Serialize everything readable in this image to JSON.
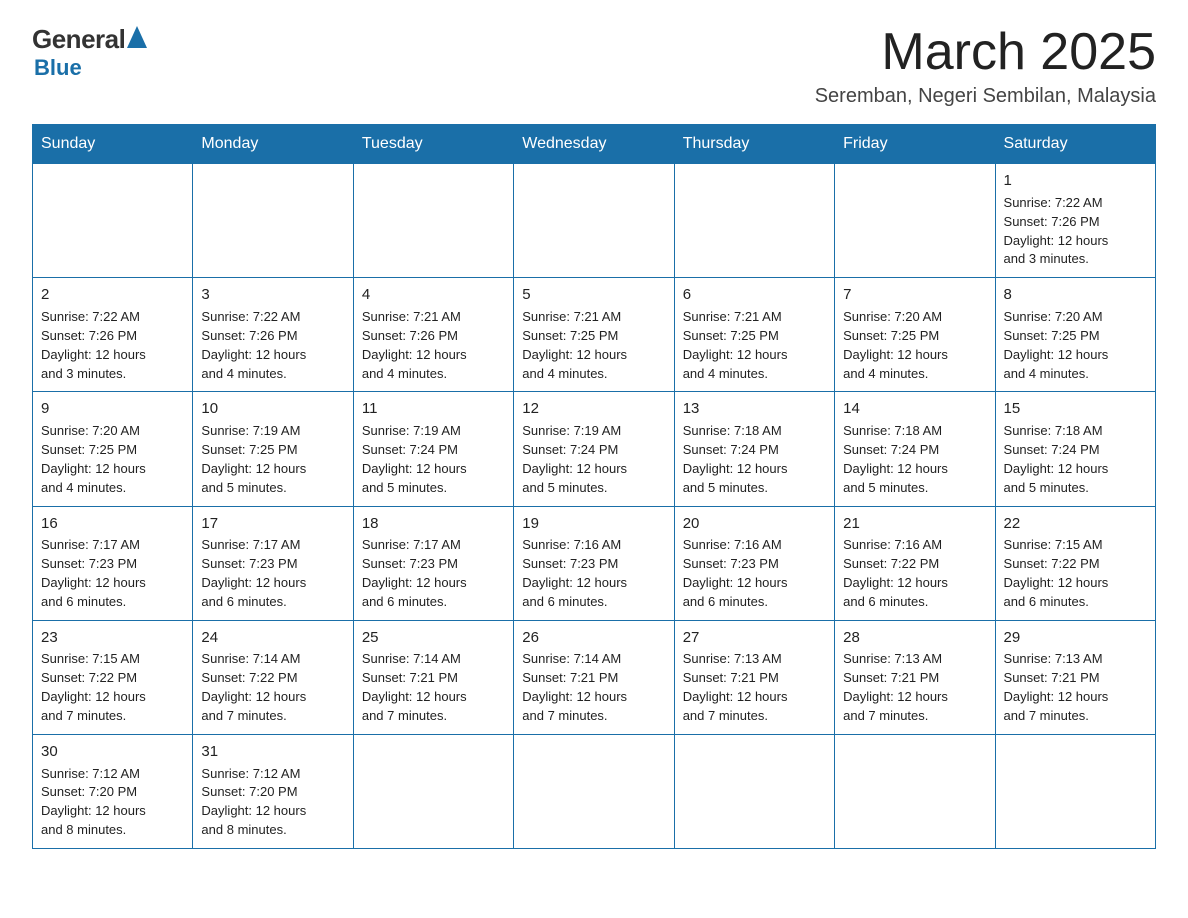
{
  "header": {
    "logo_general": "General",
    "logo_blue": "Blue",
    "month_title": "March 2025",
    "location": "Seremban, Negeri Sembilan, Malaysia"
  },
  "weekdays": [
    "Sunday",
    "Monday",
    "Tuesday",
    "Wednesday",
    "Thursday",
    "Friday",
    "Saturday"
  ],
  "weeks": [
    [
      {
        "day": "",
        "info": ""
      },
      {
        "day": "",
        "info": ""
      },
      {
        "day": "",
        "info": ""
      },
      {
        "day": "",
        "info": ""
      },
      {
        "day": "",
        "info": ""
      },
      {
        "day": "",
        "info": ""
      },
      {
        "day": "1",
        "info": "Sunrise: 7:22 AM\nSunset: 7:26 PM\nDaylight: 12 hours\nand 3 minutes."
      }
    ],
    [
      {
        "day": "2",
        "info": "Sunrise: 7:22 AM\nSunset: 7:26 PM\nDaylight: 12 hours\nand 3 minutes."
      },
      {
        "day": "3",
        "info": "Sunrise: 7:22 AM\nSunset: 7:26 PM\nDaylight: 12 hours\nand 4 minutes."
      },
      {
        "day": "4",
        "info": "Sunrise: 7:21 AM\nSunset: 7:26 PM\nDaylight: 12 hours\nand 4 minutes."
      },
      {
        "day": "5",
        "info": "Sunrise: 7:21 AM\nSunset: 7:25 PM\nDaylight: 12 hours\nand 4 minutes."
      },
      {
        "day": "6",
        "info": "Sunrise: 7:21 AM\nSunset: 7:25 PM\nDaylight: 12 hours\nand 4 minutes."
      },
      {
        "day": "7",
        "info": "Sunrise: 7:20 AM\nSunset: 7:25 PM\nDaylight: 12 hours\nand 4 minutes."
      },
      {
        "day": "8",
        "info": "Sunrise: 7:20 AM\nSunset: 7:25 PM\nDaylight: 12 hours\nand 4 minutes."
      }
    ],
    [
      {
        "day": "9",
        "info": "Sunrise: 7:20 AM\nSunset: 7:25 PM\nDaylight: 12 hours\nand 4 minutes."
      },
      {
        "day": "10",
        "info": "Sunrise: 7:19 AM\nSunset: 7:25 PM\nDaylight: 12 hours\nand 5 minutes."
      },
      {
        "day": "11",
        "info": "Sunrise: 7:19 AM\nSunset: 7:24 PM\nDaylight: 12 hours\nand 5 minutes."
      },
      {
        "day": "12",
        "info": "Sunrise: 7:19 AM\nSunset: 7:24 PM\nDaylight: 12 hours\nand 5 minutes."
      },
      {
        "day": "13",
        "info": "Sunrise: 7:18 AM\nSunset: 7:24 PM\nDaylight: 12 hours\nand 5 minutes."
      },
      {
        "day": "14",
        "info": "Sunrise: 7:18 AM\nSunset: 7:24 PM\nDaylight: 12 hours\nand 5 minutes."
      },
      {
        "day": "15",
        "info": "Sunrise: 7:18 AM\nSunset: 7:24 PM\nDaylight: 12 hours\nand 5 minutes."
      }
    ],
    [
      {
        "day": "16",
        "info": "Sunrise: 7:17 AM\nSunset: 7:23 PM\nDaylight: 12 hours\nand 6 minutes."
      },
      {
        "day": "17",
        "info": "Sunrise: 7:17 AM\nSunset: 7:23 PM\nDaylight: 12 hours\nand 6 minutes."
      },
      {
        "day": "18",
        "info": "Sunrise: 7:17 AM\nSunset: 7:23 PM\nDaylight: 12 hours\nand 6 minutes."
      },
      {
        "day": "19",
        "info": "Sunrise: 7:16 AM\nSunset: 7:23 PM\nDaylight: 12 hours\nand 6 minutes."
      },
      {
        "day": "20",
        "info": "Sunrise: 7:16 AM\nSunset: 7:23 PM\nDaylight: 12 hours\nand 6 minutes."
      },
      {
        "day": "21",
        "info": "Sunrise: 7:16 AM\nSunset: 7:22 PM\nDaylight: 12 hours\nand 6 minutes."
      },
      {
        "day": "22",
        "info": "Sunrise: 7:15 AM\nSunset: 7:22 PM\nDaylight: 12 hours\nand 6 minutes."
      }
    ],
    [
      {
        "day": "23",
        "info": "Sunrise: 7:15 AM\nSunset: 7:22 PM\nDaylight: 12 hours\nand 7 minutes."
      },
      {
        "day": "24",
        "info": "Sunrise: 7:14 AM\nSunset: 7:22 PM\nDaylight: 12 hours\nand 7 minutes."
      },
      {
        "day": "25",
        "info": "Sunrise: 7:14 AM\nSunset: 7:21 PM\nDaylight: 12 hours\nand 7 minutes."
      },
      {
        "day": "26",
        "info": "Sunrise: 7:14 AM\nSunset: 7:21 PM\nDaylight: 12 hours\nand 7 minutes."
      },
      {
        "day": "27",
        "info": "Sunrise: 7:13 AM\nSunset: 7:21 PM\nDaylight: 12 hours\nand 7 minutes."
      },
      {
        "day": "28",
        "info": "Sunrise: 7:13 AM\nSunset: 7:21 PM\nDaylight: 12 hours\nand 7 minutes."
      },
      {
        "day": "29",
        "info": "Sunrise: 7:13 AM\nSunset: 7:21 PM\nDaylight: 12 hours\nand 7 minutes."
      }
    ],
    [
      {
        "day": "30",
        "info": "Sunrise: 7:12 AM\nSunset: 7:20 PM\nDaylight: 12 hours\nand 8 minutes."
      },
      {
        "day": "31",
        "info": "Sunrise: 7:12 AM\nSunset: 7:20 PM\nDaylight: 12 hours\nand 8 minutes."
      },
      {
        "day": "",
        "info": ""
      },
      {
        "day": "",
        "info": ""
      },
      {
        "day": "",
        "info": ""
      },
      {
        "day": "",
        "info": ""
      },
      {
        "day": "",
        "info": ""
      }
    ]
  ]
}
